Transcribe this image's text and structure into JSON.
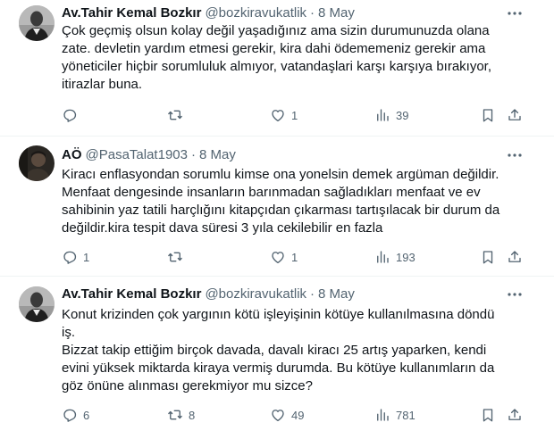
{
  "tweets": [
    {
      "name": "Av.Tahir Kemal Bozkır",
      "handle": "@bozkiravukatlik",
      "date": "8 May",
      "body": [
        "Çok geçmiş olsun kolay değil yaşadığınız ama sizin durumunuzda olana",
        "zate. devletin yardım etmesi gerekir, kira dahi ödememeniz gerekir ama",
        "yöneticiler hiçbir sorumluluk almıyor, vatandaşlari karşı karşıya bırakıyor,",
        "itirazlar buna."
      ],
      "replies": "",
      "retweets": "",
      "likes": "1",
      "views": "39"
    },
    {
      "name": "AÖ",
      "handle": "@PasaTalat1903",
      "date": "8 May",
      "body": [
        "Kiracı enflasyondan sorumlu kimse ona yonelsin demek argüman değildir.",
        "Menfaat dengesinde insanların barınmadan sağladıkları menfaat ve ev",
        "sahibinin yaz tatili harçlığını  kitapçıdan çıkarması tartışılacak bir durum da",
        "değildir.kira tespit dava süresi 3 yıla cekilebilir en fazla"
      ],
      "replies": "1",
      "retweets": "",
      "likes": "1",
      "views": "193"
    },
    {
      "name": "Av.Tahir Kemal Bozkır",
      "handle": "@bozkiravukatlik",
      "date": "8 May",
      "body": [
        "Konut krizinden çok yargının kötü işleyişinin kötüye kullanılmasına döndü",
        "iş.",
        "Bizzat  takip ettiğim birçok davada, davalı kiracı 25 artış yaparken, kendi",
        "evini yüksek miktarda kiraya vermiş durumda. Bu kötüye kullanımların da",
        "göz önüne alınması gerekmiyor mu sizce?"
      ],
      "replies": "6",
      "retweets": "8",
      "likes": "49",
      "views": "781"
    }
  ],
  "icons": {
    "more": "more-horizontal-icon",
    "reply": "reply-icon",
    "retweet": "retweet-icon",
    "like": "like-icon",
    "views": "views-icon",
    "bookmark": "bookmark-icon",
    "share": "share-icon"
  },
  "colors": {
    "text": "#0f1419",
    "muted": "#536471",
    "divider": "#eff3f4"
  }
}
